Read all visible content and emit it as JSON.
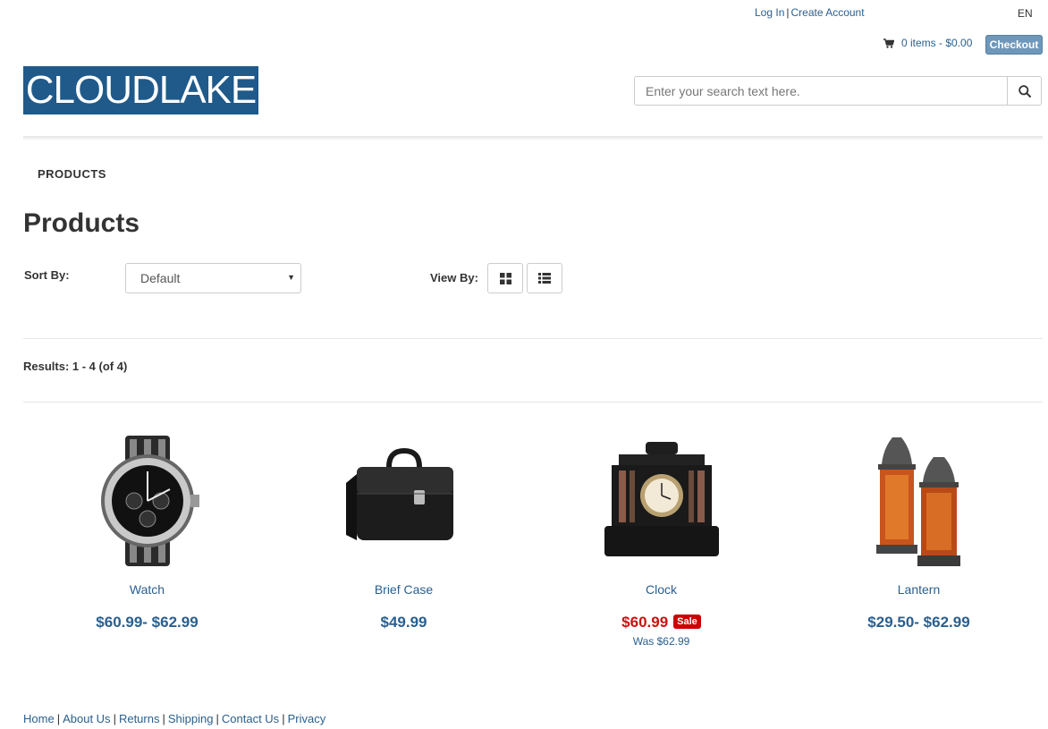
{
  "header": {
    "login": "Log In",
    "login_sep": "|",
    "create_account": "Create Account",
    "language": "EN",
    "cart_text": "0 items - $0.00",
    "checkout": "Checkout",
    "logo_text": "CLOUDLAKE",
    "search_placeholder": "Enter your search text here.",
    "search_value": ""
  },
  "nav": {
    "products": "PRODUCTS"
  },
  "page": {
    "title": "Products",
    "sort_label": "Sort By:",
    "sort_value": "Default",
    "view_label": "View By:",
    "results": "Results: 1 - 4 (of 4)"
  },
  "products": [
    {
      "name": "Watch",
      "price": "$60.99- $62.99",
      "icon": "watch-image"
    },
    {
      "name": "Brief Case",
      "price": "$49.99",
      "icon": "briefcase-image"
    },
    {
      "name": "Clock",
      "price": "$60.99",
      "badge": "Sale",
      "was": "Was  $62.99",
      "icon": "clock-image"
    },
    {
      "name": "Lantern",
      "price": "$29.50- $62.99",
      "icon": "lantern-image"
    }
  ],
  "footer": {
    "links": [
      "Home",
      "About Us",
      "Returns",
      "Shipping",
      "Contact Us",
      "Privacy"
    ],
    "sep": "|"
  },
  "colors": {
    "link": "#2a5f8f",
    "logo_bg": "#1f5a8a",
    "checkout_bg": "#6f97b9",
    "sale": "#cc0000"
  }
}
